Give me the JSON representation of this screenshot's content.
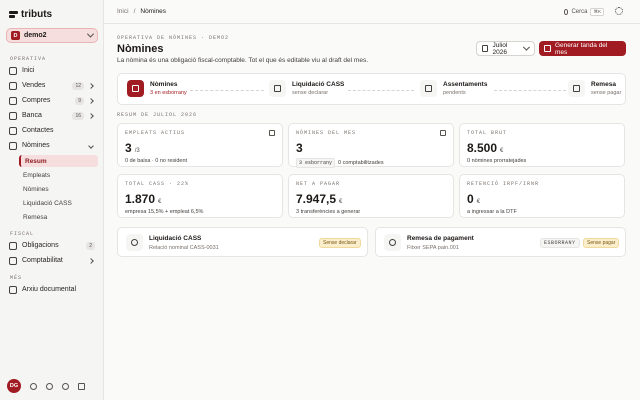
{
  "app": {
    "name": "tributs"
  },
  "org": {
    "name": "demo2",
    "initial": "D"
  },
  "sidebar": {
    "section_operativa": "OPERATIVA",
    "section_fiscal": "FISCAL",
    "section_mes": "MÉS",
    "items": {
      "inici": {
        "label": "Inici"
      },
      "vendes": {
        "label": "Vendes",
        "count": "12"
      },
      "compres": {
        "label": "Compres",
        "count": "9"
      },
      "banca": {
        "label": "Banca",
        "count": "16"
      },
      "contactes": {
        "label": "Contactes"
      },
      "nomines": {
        "label": "Nòmines"
      },
      "obligacions": {
        "label": "Obligacions",
        "count": "2"
      },
      "comptabilitat": {
        "label": "Comptabilitat"
      },
      "arxiu": {
        "label": "Arxiu documental"
      }
    },
    "nomines_sub": [
      "Resum",
      "Empleats",
      "Nòmines",
      "Liquidació CASS",
      "Remesa"
    ],
    "user_initials": "DG"
  },
  "topbar": {
    "breadcrumb_root": "Inici",
    "breadcrumb_sep": "/",
    "breadcrumb_current": "Nòmines",
    "search_label": "Cerca",
    "search_shortcut": "⌘K"
  },
  "page": {
    "eyebrow": "OPERATIVA DE NÒMINES · DEMO2",
    "title": "Nòmines",
    "subtitle": "La nòmina és una obligació fiscal-comptable. Tot el que és editable viu al draft del mes.",
    "month": "Juliol 2026",
    "primary_action": "Generar tanda del mes"
  },
  "steps": [
    {
      "title": "Nòmines",
      "sub": "3 en esborrany"
    },
    {
      "title": "Liquidació CASS",
      "sub": "sense declarar"
    },
    {
      "title": "Assentaments",
      "sub": "pendents"
    },
    {
      "title": "Remesa",
      "sub": "sense pagar"
    }
  ],
  "summary_label": "RESUM DE JULIOL 2026",
  "cards": [
    {
      "label": "EMPLEATS ACTIUS",
      "value": "3",
      "unit": "/3",
      "sub": "0 de baixa · 0 no resident"
    },
    {
      "label": "NÒMINES DEL MES",
      "value": "3",
      "unit": "",
      "chip": "3 esborrany",
      "sub": "0 comptabilitzades"
    },
    {
      "label": "TOTAL BRUT",
      "value": "8.500",
      "unit": "€",
      "sub": "0 nòmines prorratejades"
    },
    {
      "label": "TOTAL CASS · 22%",
      "value": "1.870",
      "unit": "€",
      "sub": "empresa 15,5% + empleat 6,5%"
    },
    {
      "label": "NET A PAGAR",
      "value": "7.947,5",
      "unit": "€",
      "sub": "3 transferències a generar"
    },
    {
      "label": "RETENCIÓ IRPF/IRNR",
      "value": "0",
      "unit": "€",
      "sub": "a ingressar a la DTF"
    }
  ],
  "actions": [
    {
      "title": "Liquidació CASS",
      "sub": "Relació nominal CASS-0031",
      "status": "Sense declarar"
    },
    {
      "title": "Remesa de pagament",
      "sub": "Fitxer SEPA pain.001",
      "tag": "ESBORRANY",
      "status": "Sense pagar"
    }
  ]
}
